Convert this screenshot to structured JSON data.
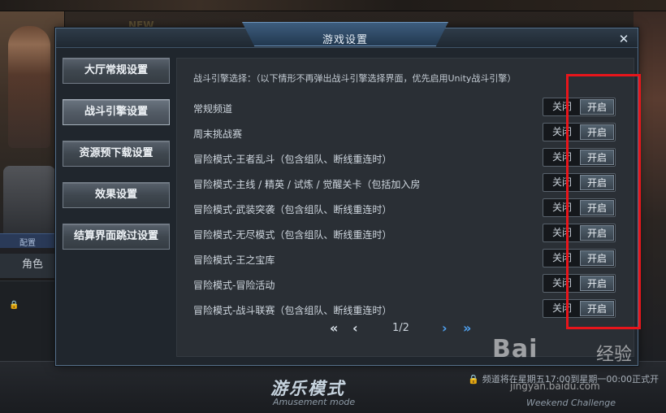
{
  "background": {
    "role_strip": "配置",
    "role_label": "角色",
    "new_badge": "NEW",
    "mode_title": "游乐模式",
    "mode_subtitle": "Amusement mode",
    "weekend_subtitle": "Weekend Challenge",
    "ticker": "频道将在星期五17:00到星期一00:00正式开"
  },
  "watermark": {
    "brand": "Bai",
    "brand_cn": "经验",
    "site": "jingyan.baidu.com"
  },
  "dialog": {
    "title": "游戏设置",
    "close_icon": "close-icon"
  },
  "sidebar": {
    "items": [
      {
        "label": "大厅常规设置",
        "active": false
      },
      {
        "label": "战斗引擎设置",
        "active": true
      },
      {
        "label": "资源预下载设置",
        "active": false
      },
      {
        "label": "效果设置",
        "active": false
      },
      {
        "label": "结算界面跳过设置",
        "active": false
      }
    ]
  },
  "content": {
    "intro": "战斗引擎选择：（以下情形不再弹出战斗引擎选择界面，优先启用Unity战斗引擎）",
    "off_label": "关闭",
    "on_label": "开启",
    "rows": [
      {
        "label": "常规频道"
      },
      {
        "label": "周末挑战赛"
      },
      {
        "label": "冒险模式-王者乱斗（包含组队、断线重连时）"
      },
      {
        "label": "冒险模式-主线 / 精英 / 试炼 / 觉醒关卡（包括加入房"
      },
      {
        "label": "冒险模式-武装突袭（包含组队、断线重连时）"
      },
      {
        "label": "冒险模式-无尽模式（包含组队、断线重连时）"
      },
      {
        "label": "冒险模式-王之宝库"
      },
      {
        "label": "冒险模式-冒险活动"
      },
      {
        "label": "冒险模式-战斗联赛（包含组队、断线重连时）"
      }
    ]
  },
  "pager": {
    "first": "«",
    "prev": "‹",
    "page": "1/2",
    "next": "›",
    "last": "»"
  },
  "colors": {
    "highlight": "#e8151b",
    "pager_active": "#4fa0ee"
  }
}
